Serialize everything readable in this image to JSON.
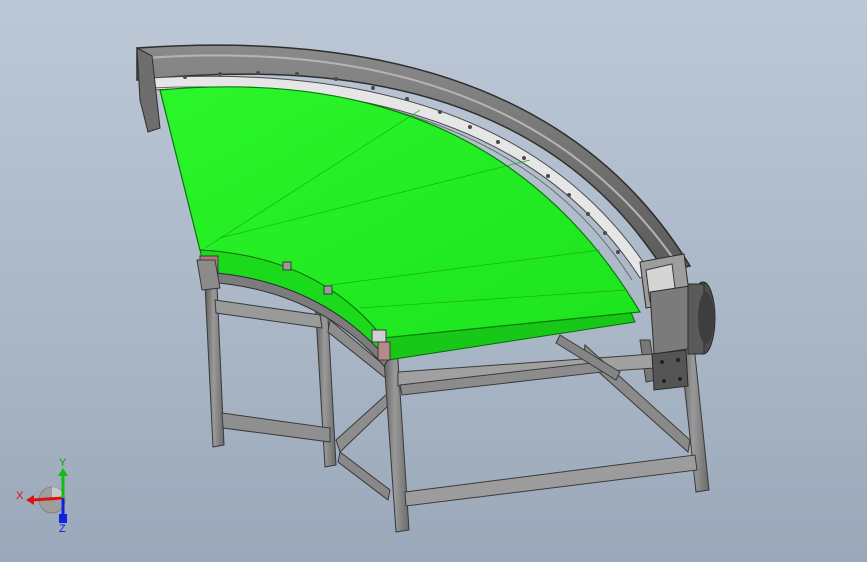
{
  "viewport": {
    "background_top": "#bcc8d6",
    "background_bottom": "#9aa8b9"
  },
  "model": {
    "belt_color": "#22ee22",
    "frame_color": "#7a7a7a"
  },
  "triad": {
    "x_label": "X",
    "y_label": "Y",
    "z_label": "Z",
    "x_color": "#e01010",
    "y_color": "#10c010",
    "z_color": "#1020e0"
  }
}
